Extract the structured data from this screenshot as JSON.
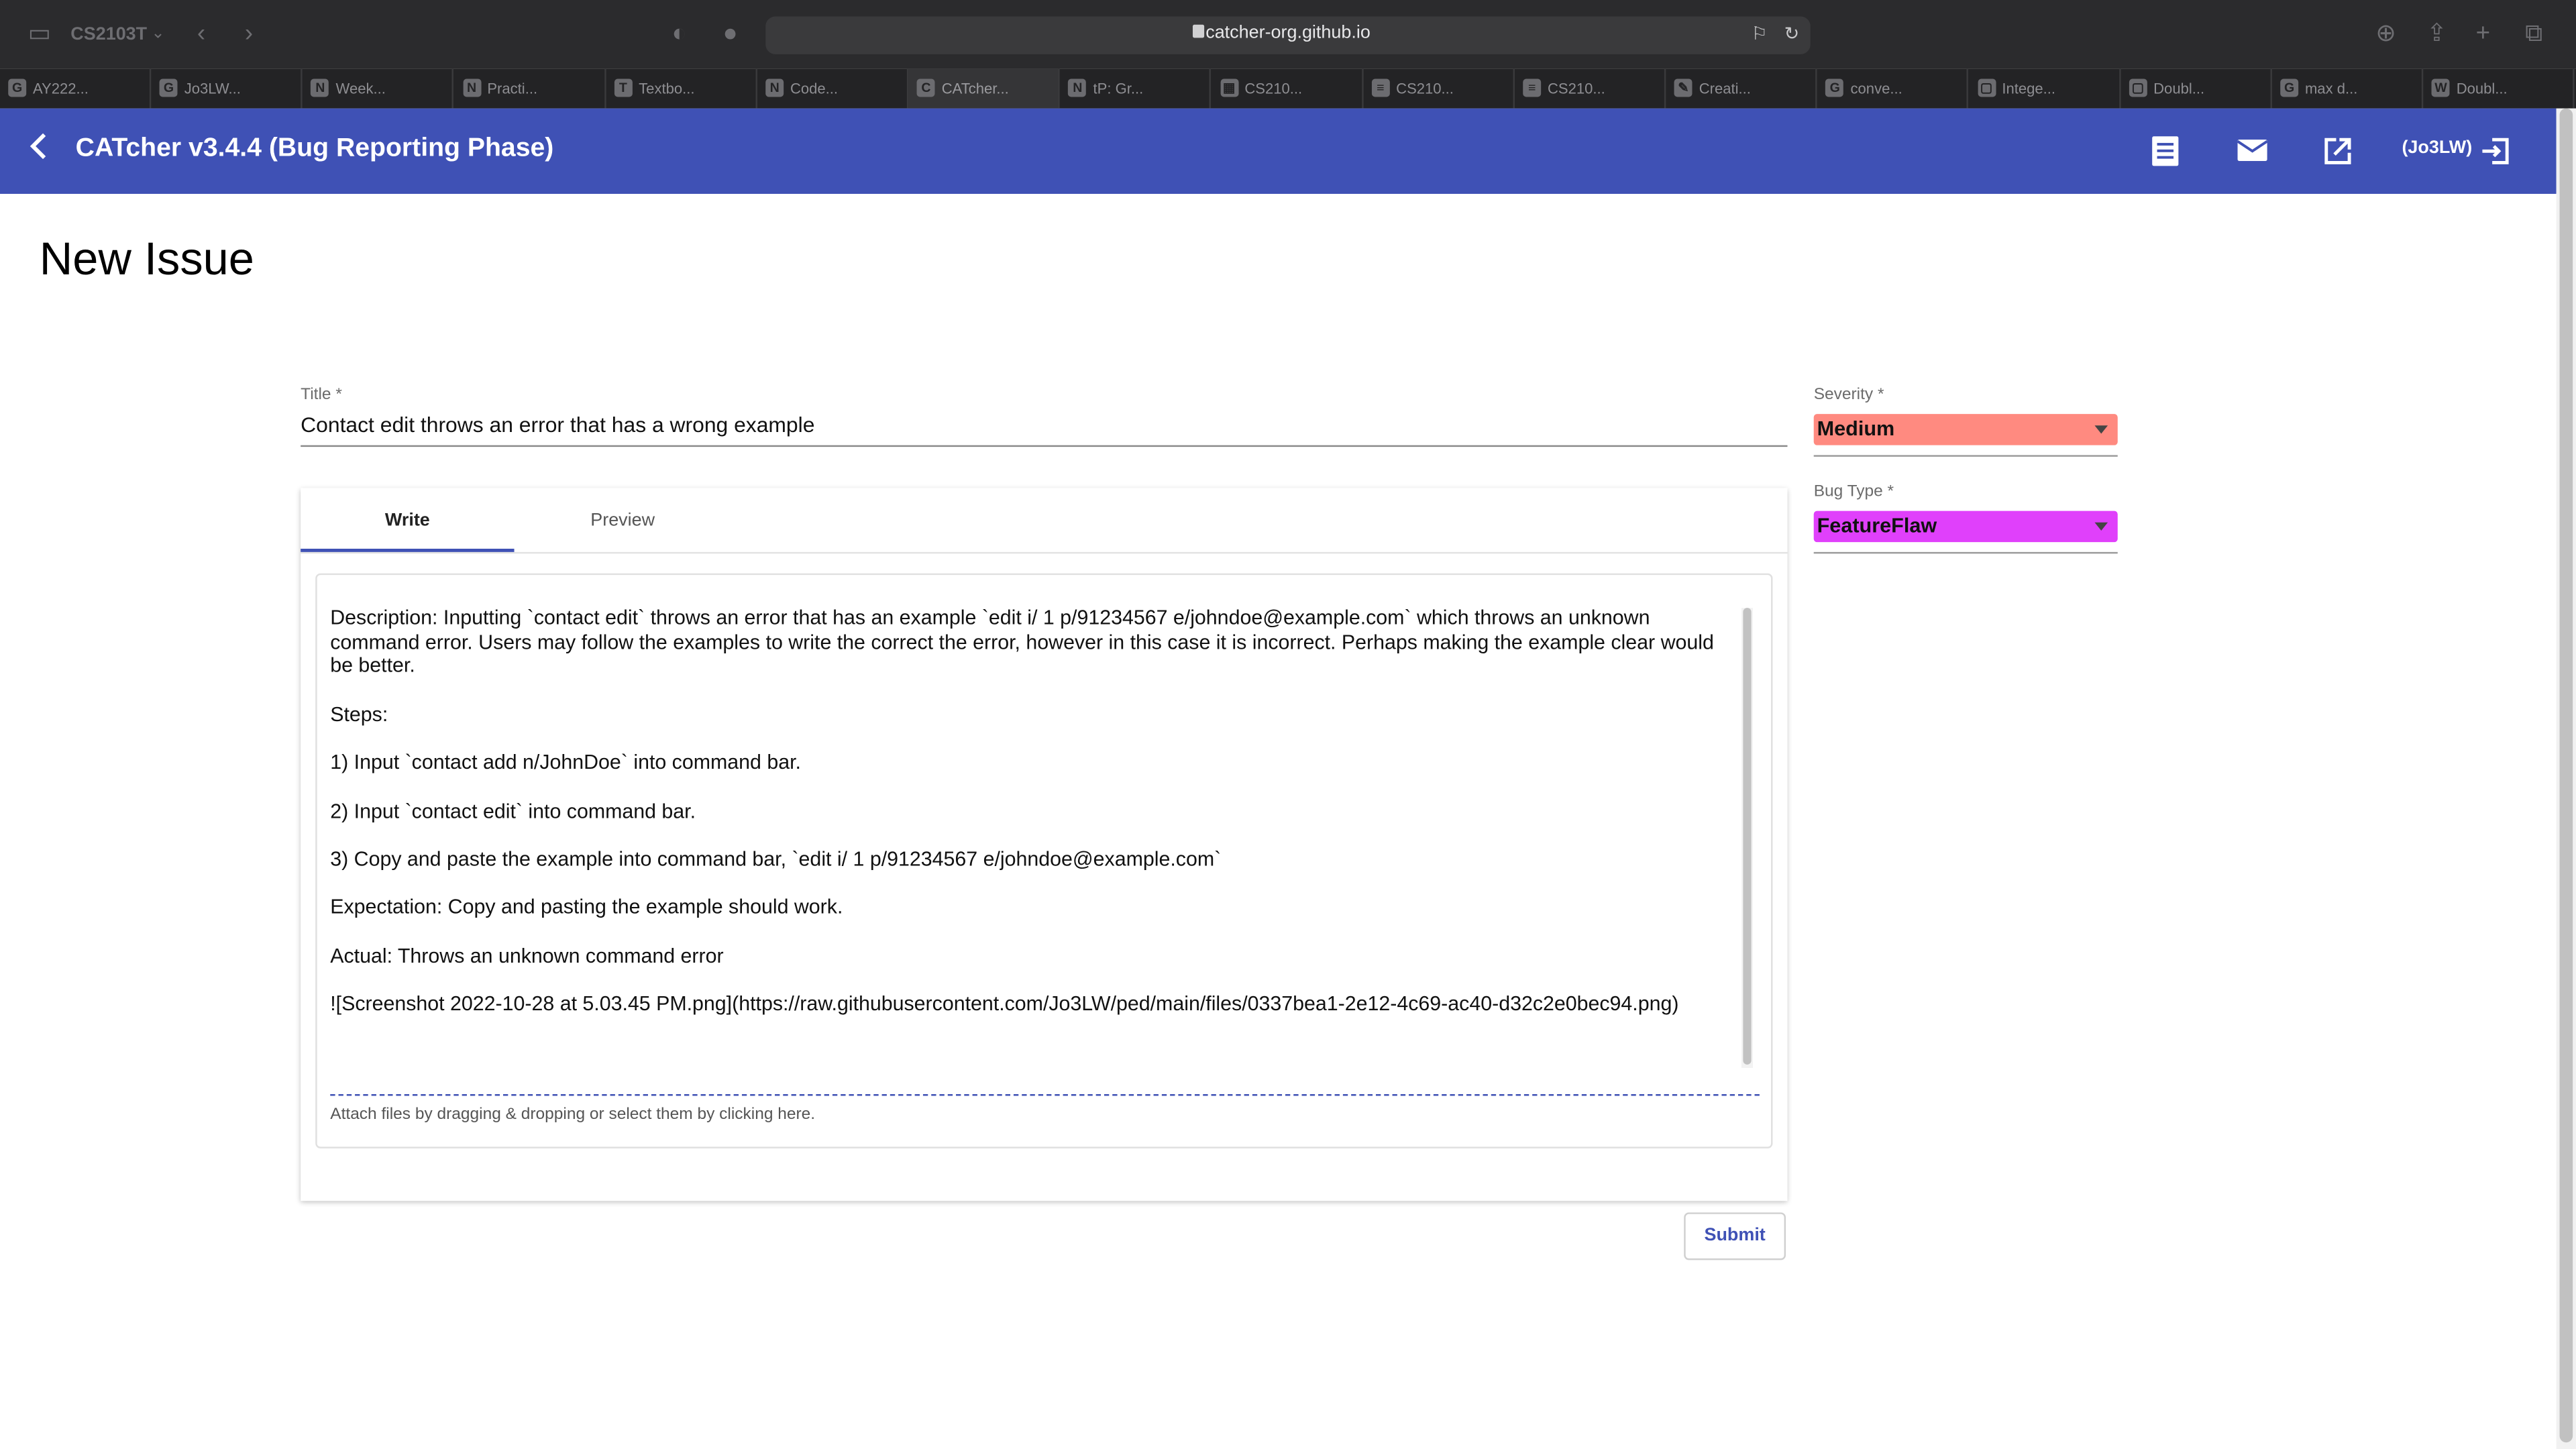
{
  "browser": {
    "profile": "CS2103T",
    "url": "catcher-org.github.io",
    "tabs": [
      {
        "label": "AY222...",
        "fav": "G"
      },
      {
        "label": "Jo3LW...",
        "fav": "G"
      },
      {
        "label": "Week...",
        "fav": "N"
      },
      {
        "label": "Practi...",
        "fav": "N"
      },
      {
        "label": "Textbo...",
        "fav": "T"
      },
      {
        "label": "Code...",
        "fav": "N"
      },
      {
        "label": "CATcher...",
        "fav": "C"
      },
      {
        "label": "tP: Gr...",
        "fav": "N"
      },
      {
        "label": "CS210...",
        "fav": "▦"
      },
      {
        "label": "CS210...",
        "fav": "≡"
      },
      {
        "label": "CS210...",
        "fav": "≡"
      },
      {
        "label": "Creati...",
        "fav": "✎"
      },
      {
        "label": "conve...",
        "fav": "G"
      },
      {
        "label": "Intege...",
        "fav": "▢"
      },
      {
        "label": "Doubl...",
        "fav": "▢"
      },
      {
        "label": "max d...",
        "fav": "G"
      },
      {
        "label": "Doubl...",
        "fav": "W"
      }
    ]
  },
  "appbar": {
    "title": "CATcher v3.4.4  (Bug Reporting Phase)",
    "user": "(Jo3LW)",
    "color": "#3f51b5"
  },
  "page": {
    "title": "New Issue"
  },
  "form": {
    "title_label": "Title *",
    "title_value": "Contact edit throws an error that has a wrong example",
    "tabs": {
      "write": "Write",
      "preview": "Preview"
    },
    "description": "Description: Inputting `contact edit` throws an error that has an example `edit i/ 1 p/91234567 e/johndoe@example.com` which throws an unknown command error. Users may follow the examples to write the correct the error, however in this case it is incorrect. Perhaps making the example clear would be better.\n\nSteps:\n\n1) Input `contact add n/JohnDoe` into command bar.\n\n2) Input `contact edit` into command bar.\n\n3) Copy and paste the example into command bar, `edit i/ 1 p/91234567 e/johndoe@example.com`\n\nExpectation: Copy and pasting the example should work.\n\nActual: Throws an unknown command error\n\n![Screenshot 2022-10-28 at 5.03.45 PM.png](https://raw.githubusercontent.com/Jo3LW/ped/main/files/0337bea1-2e12-4c69-ac40-d32c2e0bec94.png)",
    "attach_hint": "Attach files by dragging & dropping or select them by clicking here.",
    "submit": "Submit",
    "severity_label": "Severity *",
    "severity_value": "Medium",
    "severity_color": "#ff8a80",
    "bugtype_label": "Bug Type *",
    "bugtype_value": "FeatureFlaw",
    "bugtype_color": "#e040fb"
  }
}
